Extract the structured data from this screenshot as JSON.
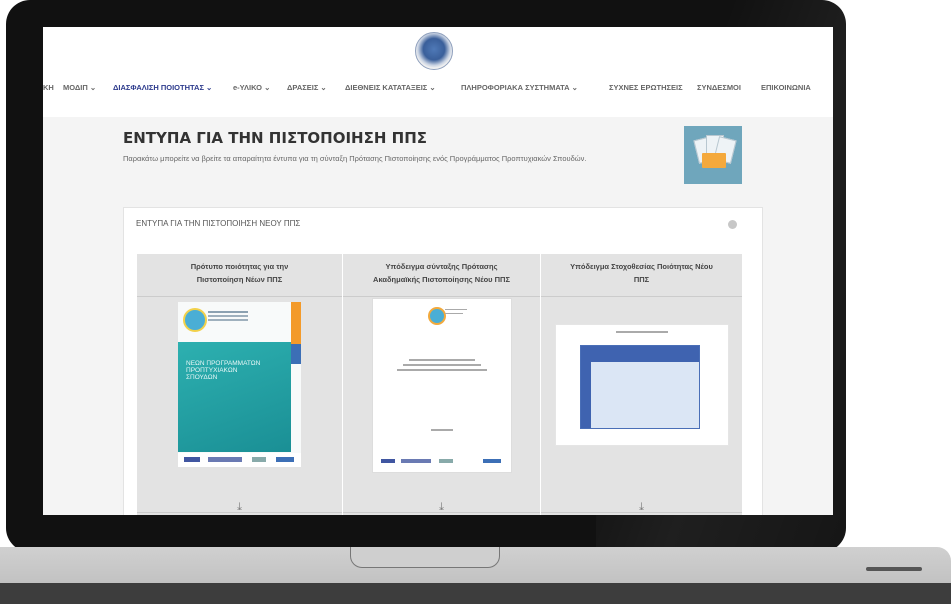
{
  "nav": {
    "items": [
      {
        "label": "ΚΗ",
        "active": false
      },
      {
        "label": "ΜΟΔΙΠ ⌄",
        "active": false
      },
      {
        "label": "ΔΙΑΣΦΑΛΙΣΗ ΠΟΙΟΤΗΤΑΣ ⌄",
        "active": true
      },
      {
        "label": "e-ΥΛΙΚΟ ⌄",
        "active": false
      },
      {
        "label": "ΔΡΑΣΕΙΣ ⌄",
        "active": false
      },
      {
        "label": "ΔΙΕΘΝΕΙΣ ΚΑΤΑΤΑΞΕΙΣ ⌄",
        "active": false
      },
      {
        "label": "ΠΛΗΡΟΦΟΡΙΑΚΑ ΣΥΣΤΗΜΑΤΑ ⌄",
        "active": false
      },
      {
        "label": "ΣΥΧΝΕΣ ΕΡΩΤΗΣΕΙΣ",
        "active": false
      },
      {
        "label": "ΣΥΝΔΕΣΜΟΙ",
        "active": false
      },
      {
        "label": "ΕΠΙΚΟΙΝΩΝΙΑ",
        "active": false
      }
    ]
  },
  "page": {
    "title": "ΕΝΤΥΠΑ ΓΙΑ ΤΗΝ ΠΙΣΤΟΠΟΙΗΣΗ ΠΠΣ",
    "subtitle": "Παρακάτω μπορείτε να βρείτε τα απαραίτητα έντυπα για τη σύνταξη Πρότασης Πιστοποίησης ενός Προγράμματος Προπτυχιακών Σπουδών."
  },
  "panel": {
    "title": "ΕΝΤΥΠΑ ΓΙΑ ΤΗΝ ΠΙΣΤΟΠΟΙΗΣΗ ΝΕΟΥ ΠΠΣ"
  },
  "documents": [
    {
      "title_line1": "Πρότυπο ποιότητας για την",
      "title_line2": "Πιστοποίηση Νέων ΠΠΣ",
      "cover_text": "ΝΕΩΝ ΠΡΟΓΡΑΜΜΑΤΩΝ ΠΡΟΠΤΥΧΙΑΚΩΝ ΣΠΟΥΔΩΝ",
      "download_icon": "download-icon"
    },
    {
      "title_line1": "Υπόδειγμα σύνταξης Πρότασης",
      "title_line2": "Ακαδημαϊκής Πιστοποίησης Νέου ΠΠΣ",
      "download_icon": "download-icon"
    },
    {
      "title_line1": "Υπόδειγμα Στοχοθεσίας Ποιότητας Νέου",
      "title_line2": "ΠΠΣ",
      "download_icon": "download-icon"
    }
  ],
  "glyphs": {
    "download": "⤓"
  },
  "colors": {
    "active_nav": "#2c3a8c",
    "teal_cover": "#1a9a9e",
    "orange_accent": "#f39a2a",
    "table_blue": "#3f63b0"
  }
}
